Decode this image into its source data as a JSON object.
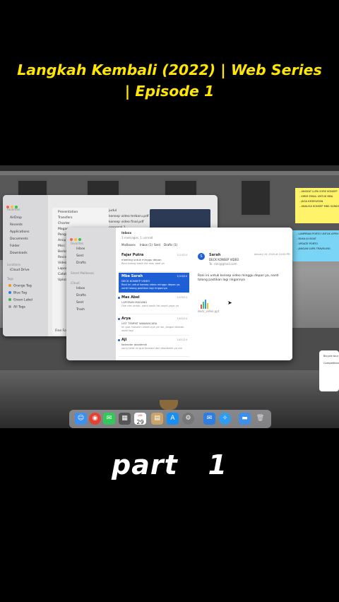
{
  "overlay": {
    "title_line1": "Langkah Kembali (2022) | Web Series",
    "title_line2": "| Episode 1",
    "part_label": "part   1"
  },
  "colors": {
    "title": "#ffe600",
    "selection": "#1f5fd6",
    "sticky_yellow": "#fff36a",
    "sticky_blue": "#7ad4f5"
  },
  "finder": {
    "sidebar_sections": [
      "Favorites",
      "Locations",
      "Tags"
    ],
    "sidebar_items": [
      "AirDrop",
      "Recents",
      "Applications",
      "Documents",
      "Folder",
      "Downloads",
      "iCloud Drive"
    ],
    "tags": [
      {
        "label": "Orange Tag",
        "color": "#f0932b"
      },
      {
        "label": "Blue Tag",
        "color": "#2f7fe0"
      },
      {
        "label": "Green Label",
        "color": "#3bb54a"
      },
      {
        "label": "All Tags",
        "color": "#999999"
      }
    ],
    "col2_items": [
      "Presentation",
      "Transfers",
      "Charter",
      "Magang",
      "Pengaturan",
      "Arsip",
      "Misc",
      "Berkas",
      "Revisi",
      "Video",
      "Laporan",
      "Catatan",
      "Upload"
    ],
    "col3_items": [
      "judul",
      "konsep video terbaru.pdf",
      "konsep video final.pdf",
      "proposal 1"
    ],
    "footer": "Fine Folder"
  },
  "mail": {
    "header_title": "Inbox",
    "header_subtitle": "3 messages, 1 unread",
    "mailbox_tabs": [
      "Mailboxes",
      "Inbox (1)",
      "Sent",
      "Drafts (1)"
    ],
    "sidebar": {
      "favorites_label": "Favorites",
      "favorites": [
        "Inbox",
        "Sent",
        "Drafts"
      ],
      "smart_label": "Smart Mailboxes",
      "mailboxes_label": "iCloud",
      "mailboxes": [
        "Inbox",
        "Drafts",
        "Sent",
        "Trash"
      ]
    },
    "messages": [
      {
        "name": "Fajar Putra",
        "date": "1/14/24",
        "subject": "meeting untuk minggu depan",
        "preview": "Rani tolong kasih list mau abel ya"
      },
      {
        "name": "Mba Sarah",
        "date": "1/10/24",
        "subject": "DECK KONSEP VIDEO",
        "preview": "Rani ini untuk konsep video minggu depan ya, nanti tolong pastikan lagi ringannya"
      },
      {
        "name": "Mas Abel",
        "date": "1/09/24",
        "subject": "LAPORAN MAGANG",
        "preview": "Oke rani aman, nanti kasih list saudi yaya ya"
      },
      {
        "name": "Arya",
        "date": "1/05/24",
        "subject": "LIST TEMPAT WAWANCARA",
        "preview": "Ini gue masukin sheet-nya ya ran, jangan diubah-ubah lagi"
      },
      {
        "name": "Aji",
        "date": "1/01/24",
        "subject": "kalender akademik",
        "preview": "sorry telat ini gue forward dari akademik ya ran"
      }
    ],
    "reader": {
      "sender": "Sarah",
      "avatar_letter": "S",
      "subject": "DECK KONSEP VIDEO",
      "to": "To: rani@gmail.com",
      "date": "January 10, 2024 at 10:00 PM",
      "body": "Rani ini untuk konsep video minggu depan ya, nanti tolong pastikan lagi ringannya",
      "attachment": "deck_video.ppt"
    }
  },
  "sticky_notes": {
    "yellow": [
      "- ANGKAT LUPA SORE KONSEP",
      "- KIRIM EMAIL UNTUK MBA",
      "- JAGA KESEHATAN",
      "- ANALISA KONSEP MBA SARAH"
    ],
    "blue": [
      "- LAMPIRAN PORTO UNTUK APPLY BESOK",
      "- BUKA JU BOAT",
      "- UPDATE PORTO",
      "- JANGAN LUPA TRAVELING"
    ]
  },
  "widget": {
    "items": [
      "Bicycle tour",
      "Competition"
    ]
  },
  "dock": {
    "calendar_month": "JAN",
    "calendar_day": "29",
    "icons": [
      "finder-icon",
      "chrome-icon",
      "messages-icon",
      "calculator-icon",
      "calendar-icon",
      "notes-icon",
      "app-store-icon",
      "settings-icon",
      "mail-icon",
      "safari-icon",
      "folder-icon",
      "trash-icon"
    ]
  }
}
